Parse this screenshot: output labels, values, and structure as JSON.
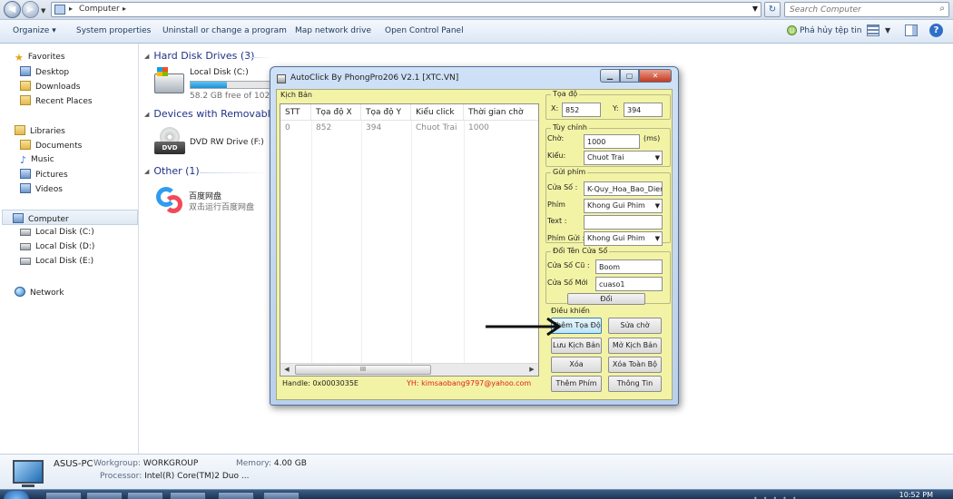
{
  "explorer": {
    "address": {
      "crumb": "Computer"
    },
    "search": {
      "placeholder": "Search Computer"
    },
    "toolbar": {
      "organize": "Organize",
      "system_properties": "System properties",
      "uninstall": "Uninstall or change a program",
      "map_drive": "Map network drive",
      "control_panel": "Open Control Panel",
      "right_action": "Phá hủy tệp tin"
    },
    "nav": {
      "favorites": "Favorites",
      "desktop": "Desktop",
      "downloads": "Downloads",
      "recent": "Recent Places",
      "libraries": "Libraries",
      "documents": "Documents",
      "music": "Music",
      "pictures": "Pictures",
      "videos": "Videos",
      "computer": "Computer",
      "disk_c": "Local Disk (C:)",
      "disk_d": "Local Disk (D:)",
      "disk_e": "Local Disk (E:)",
      "network": "Network"
    },
    "groups": {
      "hdd": "Hard Disk Drives (3)",
      "removable": "Devices with Removable",
      "other": "Other (1)"
    },
    "drives": {
      "c_name": "Local Disk (C:)",
      "c_free": "58.2 GB free of 102 GB",
      "c_used_fraction": 0.43,
      "dvd_name": "DVD RW Drive (F:)",
      "dvd_label": "DVD",
      "baidu_name": "百度网盘",
      "baidu_sub": "双击运行百度网盘"
    },
    "details": {
      "pc_name": "ASUS-PC",
      "workgroup_label": "Workgroup:",
      "workgroup": "WORKGROUP",
      "memory_label": "Memory:",
      "memory": "4.00 GB",
      "processor_label": "Processor:",
      "processor": "Intel(R) Core(TM)2 Duo ..."
    },
    "clock": "10:52 PM"
  },
  "autoclick": {
    "title": "AutoClick By PhongPro206 V2.1 [XTC.VN]",
    "script_group": "Kịch Bản",
    "columns": [
      "STT",
      "Tọa độ X",
      "Tọa độ Y",
      "Kiểu click",
      "Thời gian chờ"
    ],
    "rows": [
      [
        "0",
        "852",
        "394",
        "Chuot Trai",
        "1000"
      ]
    ],
    "scroll_grip": "III",
    "handle": "Handle: 0x0003035E",
    "email": "YH: kimsaobang9797@yahoo.com",
    "coords": {
      "group": "Tọa độ",
      "x_label": "X:",
      "x": "852",
      "y_label": "Y:",
      "y": "394"
    },
    "custom": {
      "group": "Tùy chỉnh",
      "wait_label": "Chờ:",
      "wait": "1000",
      "unit": "(ms)",
      "type_label": "Kiểu:",
      "type": "Chuot Trai"
    },
    "sendkey": {
      "group": "Gửi phím",
      "window_label": "Cửa Số :",
      "window": "K-Quy_Hoa_Bao_Dien",
      "key_label": "Phím",
      "key": "Khong Gui Phim",
      "text_label": "Text :",
      "text": "",
      "sendkey_label": "Phím Gửi :",
      "sendkey": "Khong Gui Phim"
    },
    "rename": {
      "group": "Đổi Tên Cửa Sổ",
      "old_label": "Cửa Số Cũ :",
      "old": "Boom",
      "new_label": "Cửa Số Mới",
      "new": "cuaso1",
      "button": "Đổi"
    },
    "control": {
      "group": "Điều khiển",
      "add": "Thêm Tọa Độ",
      "edit_wait": "Sửa chờ",
      "save": "Lưu Kịch Bản",
      "open": "Mở Kịch Bản",
      "delete": "Xóa",
      "delete_all": "Xóa Toàn Bộ",
      "add_key": "Thêm Phím",
      "info": "Thông Tin"
    }
  }
}
